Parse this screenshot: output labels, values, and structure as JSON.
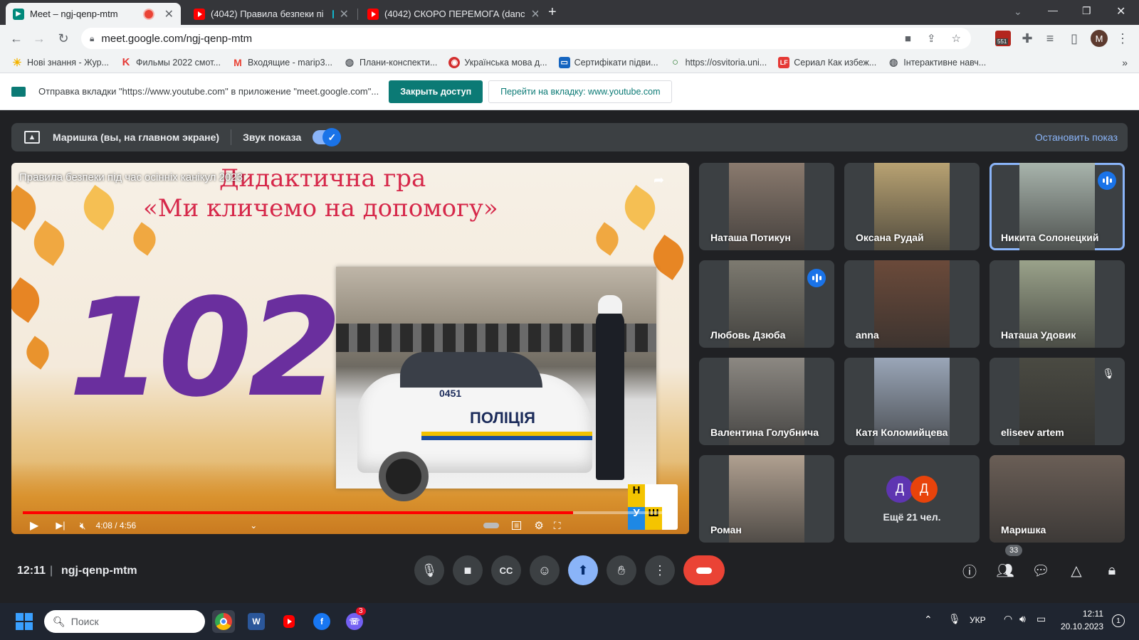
{
  "browser": {
    "tabs": [
      {
        "title": "Meet – ngj-qenp-mtm",
        "icon": "google-meet-icon",
        "active": true
      },
      {
        "title": "(4042) Правила безпеки пі",
        "icon": "youtube-icon",
        "active": false
      },
      {
        "title": "(4042) СКОРО ПЕРЕМОГА (danc",
        "icon": "youtube-icon",
        "active": false
      }
    ],
    "new_tab": "+",
    "url": "meet.google.com/ngj-qenp-mtm",
    "profile_initial": "M",
    "extension_badge": "551",
    "bookmarks": [
      {
        "label": "Нові знання - Жур...",
        "icon": "sun-icon"
      },
      {
        "label": "Фильмы 2022 смот...",
        "icon": "k-icon"
      },
      {
        "label": "Входящие - marip3...",
        "icon": "gmail-icon"
      },
      {
        "label": "Плани-конспекти...",
        "icon": "globe-icon"
      },
      {
        "label": "Українська мова д...",
        "icon": "red-logo-icon"
      },
      {
        "label": "Сертифікати підви...",
        "icon": "book-icon"
      },
      {
        "label": "https://osvitoria.uni...",
        "icon": "green-ring-icon"
      },
      {
        "label": "Сериал Как избеж...",
        "icon": "lf-icon"
      },
      {
        "label": "Інтерактивне навч...",
        "icon": "globe-icon"
      }
    ],
    "bookmarks_more": "»"
  },
  "banner": {
    "message": "Отправка вкладки \"https://www.youtube.com\" в приложение \"meet.google.com\"...",
    "close_access": "Закрыть доступ",
    "goto_tab": "Перейти на вкладку: www.youtube.com"
  },
  "presenting": {
    "label": "Маришка (вы, на главном экране)",
    "sound_label": "Звук показа",
    "sound_on": true,
    "stop_label": "Остановить показ"
  },
  "video": {
    "title": "Правила безпеки під час осінніх канікул 2023",
    "slide_title_1": "Дидактична гра",
    "slide_title_2": "«Ми кличемо на допомогу»",
    "big_number": "102",
    "car_number": "0451",
    "car_text": "ПОЛІЦІЯ",
    "time": "4:08 / 4:56",
    "progress": 0.84
  },
  "participants": [
    {
      "name": "Наташа Потикун",
      "speaking": false,
      "muted": false,
      "bg": "#8a7a6e"
    },
    {
      "name": "Оксана Рудай",
      "speaking": false,
      "muted": false,
      "bg": "#b8a272"
    },
    {
      "name": "Никита Солонецкий",
      "speaking": true,
      "muted": false,
      "bg": "#a8b4ac",
      "active": true
    },
    {
      "name": "Любовь Дзюба",
      "speaking": true,
      "muted": false,
      "bg": "#7d7a70"
    },
    {
      "name": "anna",
      "speaking": false,
      "muted": false,
      "bg": "#6b4a3a"
    },
    {
      "name": "Наташа Удовик",
      "speaking": false,
      "muted": false,
      "bg": "#9aa28a"
    },
    {
      "name": "Валентина Голубнича",
      "speaking": false,
      "muted": false,
      "bg": "#8c8882"
    },
    {
      "name": "Катя Коломийцева",
      "speaking": false,
      "muted": false,
      "bg": "#9aa6b8"
    },
    {
      "name": "eliseev artem",
      "speaking": false,
      "muted": true,
      "bg": "#4a4a42"
    },
    {
      "name": "Роман",
      "speaking": false,
      "muted": false,
      "bg": "#b0a090"
    },
    {
      "name": "Ещё 21 чел.",
      "speaking": false,
      "muted": false,
      "bg": "#3c4043",
      "avatars": [
        "Д",
        "Д"
      ]
    },
    {
      "name": "Маришка",
      "speaking": false,
      "muted": false,
      "bg": "#6a5e56"
    }
  ],
  "bottom": {
    "time": "12:11",
    "separator": "|",
    "meeting_code": "ngj-qenp-mtm",
    "participant_count": "33"
  },
  "taskbar": {
    "search_placeholder": "Поиск",
    "viber_badge": "3",
    "language": "УКР",
    "clock_time": "12:11",
    "clock_date": "20.10.2023",
    "notification_badge": "1"
  },
  "colors": {
    "meet_bg": "#202124",
    "accent_blue": "#1a73e8",
    "end_call_red": "#ea4335",
    "teal": "#0b7a75"
  }
}
